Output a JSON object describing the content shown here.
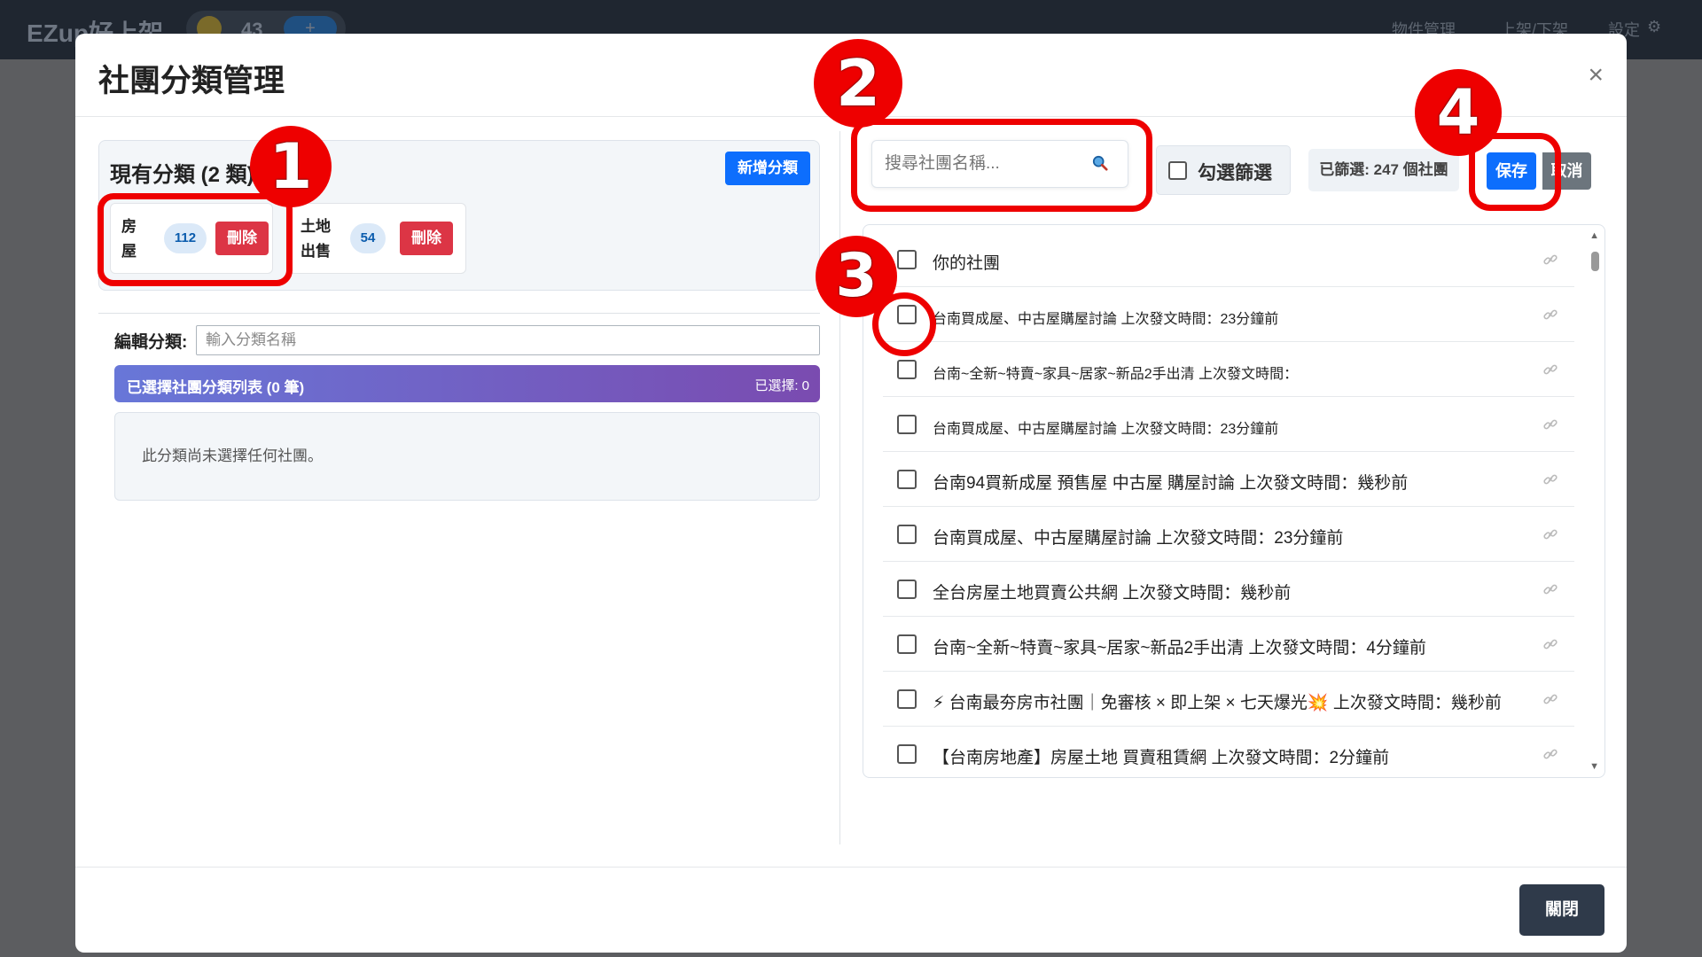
{
  "appbar": {
    "brand": "EZup好上架",
    "coins": "43",
    "coin_plus": "+",
    "nav": [
      "物件管理",
      "上架/下架",
      "設定"
    ]
  },
  "modal": {
    "title": "社團分類管理",
    "close_icon": "×"
  },
  "categories": {
    "header": "現有分類 (2 類)",
    "add_button": "新增分類",
    "items": [
      {
        "name": "房屋",
        "count": "112",
        "delete": "刪除"
      },
      {
        "name": "土地出售",
        "count": "54",
        "delete": "刪除"
      }
    ]
  },
  "editor": {
    "label": "編輯分類:",
    "placeholder": "輸入分類名稱",
    "selected_title": "已選擇社團分類列表 (0 筆)",
    "selected_count": "已選擇: 0",
    "empty_text": "此分類尚未選擇任何社團。"
  },
  "search": {
    "placeholder": "搜尋社團名稱..."
  },
  "filter": {
    "checkbox_label": "勾選篩選",
    "filtered_info": "已篩選: 247 個社團",
    "save": "保存",
    "cancel": "取消"
  },
  "groups": [
    {
      "name": "你的社團",
      "small": false
    },
    {
      "name": "台南買成屋、中古屋購屋討論 上次發文時間：23分鐘前",
      "small": true
    },
    {
      "name": "台南~全新~特賣~家具~居家~新品2手出清 上次發文時間：",
      "small": true
    },
    {
      "name": "台南買成屋、中古屋購屋討論 上次發文時間：23分鐘前",
      "small": true
    },
    {
      "name": "台南94買新成屋 預售屋 中古屋 購屋討論 上次發文時間：幾秒前",
      "small": false
    },
    {
      "name": "台南買成屋、中古屋購屋討論 上次發文時間：23分鐘前",
      "small": false
    },
    {
      "name": "全台房屋土地買賣公共網 上次發文時間：幾秒前",
      "small": false
    },
    {
      "name": "台南~全新~特賣~家具~居家~新品2手出清 上次發文時間：4分鐘前",
      "small": false
    },
    {
      "name": "⚡ 台南最夯房市社團｜免審核 × 即上架 × 七天爆光💥 上次發文時間：幾秒前",
      "small": false
    },
    {
      "name": "【台南房地產】房屋土地 買賣租賃網 上次發文時間：2分鐘前",
      "small": false
    }
  ],
  "footer": {
    "close": "關閉"
  },
  "annotations": [
    "1",
    "2",
    "3",
    "4"
  ],
  "colors": {
    "primary": "#0d6efd",
    "danger": "#dc3545",
    "annotation": "#ee0000",
    "dark_button": "#2f3a4a"
  }
}
